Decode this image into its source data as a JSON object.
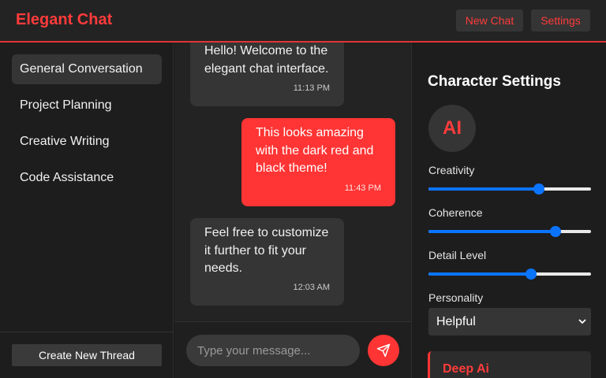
{
  "header": {
    "brand": "Elegant Chat",
    "new_chat_label": "New Chat",
    "settings_label": "Settings"
  },
  "sidebar": {
    "threads": [
      {
        "label": "General Conversation",
        "active": true
      },
      {
        "label": "Project Planning",
        "active": false
      },
      {
        "label": "Creative Writing",
        "active": false
      },
      {
        "label": "Code Assistance",
        "active": false
      }
    ],
    "create_thread_label": "Create New Thread"
  },
  "chat": {
    "messages": [
      {
        "sender": "bot",
        "text": "Hello! Welcome to the elegant chat interface.",
        "time": "11:13 PM"
      },
      {
        "sender": "user",
        "text": "This looks amazing with the dark red and black theme!",
        "time": "11:43 PM"
      },
      {
        "sender": "bot",
        "text": "Feel free to customize it further to fit your needs.",
        "time": "12:03 AM"
      }
    ],
    "input_placeholder": "Type your message...",
    "input_value": ""
  },
  "settings": {
    "title": "Character Settings",
    "avatar_text": "AI",
    "sliders": [
      {
        "label": "Creativity",
        "value": 0.68
      },
      {
        "label": "Coherence",
        "value": 0.78
      },
      {
        "label": "Detail Level",
        "value": 0.63
      }
    ],
    "personality_label": "Personality",
    "personality_value": "Helpful",
    "card_title": "Deep Ai"
  },
  "colors": {
    "accent": "#ff3434",
    "slider": "#0b74ff",
    "background": "#1a1a1a"
  },
  "icons": {
    "send": "paper-plane-icon",
    "select": "chevron-down-icon"
  }
}
